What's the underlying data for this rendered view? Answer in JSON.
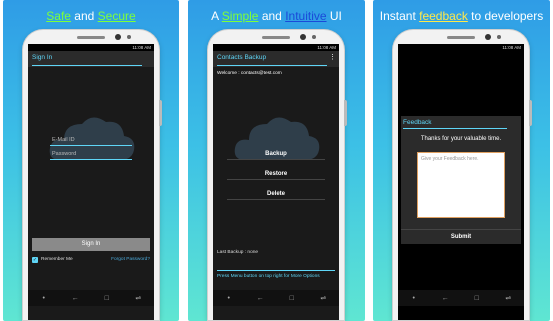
{
  "panels": [
    {
      "caption": {
        "w1": "Safe",
        "w2": " and ",
        "w3": "Secure"
      },
      "status_time": "11:08 AM",
      "title": "Sign In",
      "email_placeholder": "E-Mail ID",
      "password_placeholder": "Password",
      "signin_label": "Sign In",
      "remember_label": "Remember Me",
      "forgot_label": "Forgot Password?",
      "nav": [
        "•",
        "←",
        "□",
        "⇌"
      ]
    },
    {
      "caption": {
        "w1": "A ",
        "w2": "Simple",
        "w3": " and ",
        "w4": "Intuitive",
        "w5": " UI"
      },
      "status_time": "11:08 AM",
      "title": "Contacts Backup",
      "menu_icon": "⋮",
      "welcome": "Welcome : contacts@test.com",
      "actions": [
        "Backup",
        "Restore",
        "Delete"
      ],
      "last_backup": "Last Backup : none",
      "hint": "Press Menu button on top right for More Options",
      "nav": [
        "•",
        "←",
        "□",
        "⇌"
      ]
    },
    {
      "caption": {
        "w1": "Instant ",
        "w2": "feedback",
        "w3": " to developers"
      },
      "status_time": "11:08 AM",
      "dialog_title": "Feedback",
      "dialog_message": "Thanks for your valuable time.",
      "feedback_placeholder": "Give your Feedback here.",
      "submit_label": "Submit",
      "nav": [
        "•",
        "←",
        "□",
        "⇌"
      ]
    }
  ]
}
